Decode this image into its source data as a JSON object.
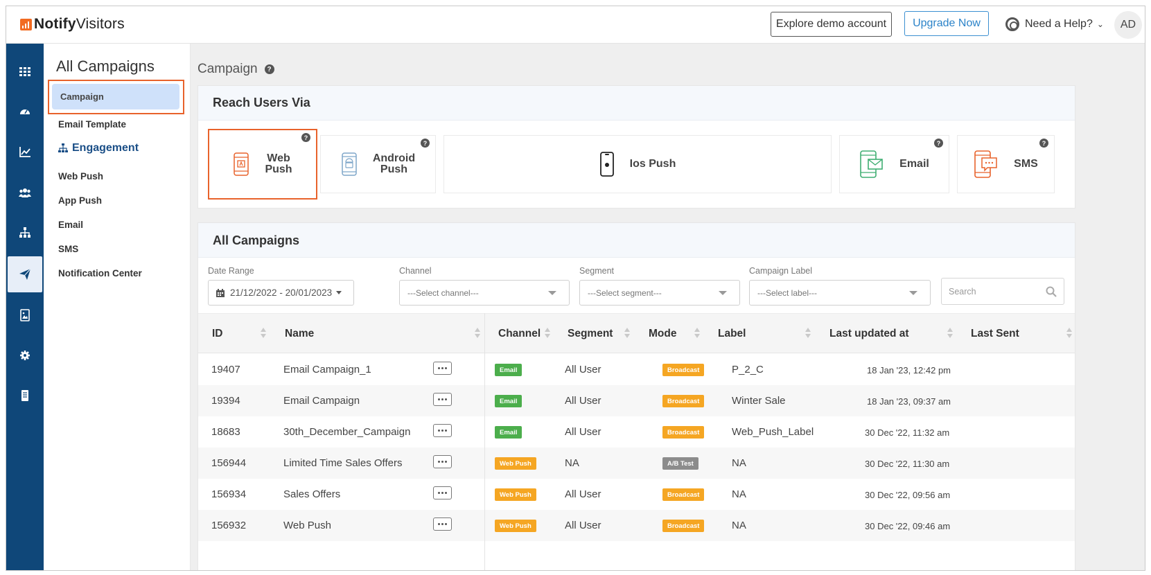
{
  "header": {
    "logo_bold": "Notify",
    "logo_regular": "Visitors",
    "demo_button": "Explore demo account",
    "upgrade_button": "Upgrade Now",
    "help_label": "Need a Help?",
    "avatar_initials": "AD"
  },
  "rail": {
    "icons": [
      "grid-icon",
      "dashboard-icon",
      "analytics-icon",
      "users-icon",
      "sitemap-icon",
      "send-icon",
      "image-icon",
      "settings-icon",
      "document-icon"
    ],
    "active_icon": "send-icon"
  },
  "subnav": {
    "title": "All Campaigns",
    "campaign": "Campaign",
    "email_template": "Email Template",
    "engagement": "Engagement",
    "items": [
      "Web Push",
      "App Push",
      "Email",
      "SMS",
      "Notification Center"
    ]
  },
  "main": {
    "page_title": "Campaign",
    "reach_title": "Reach Users Via",
    "channels": [
      {
        "line1": "Web",
        "line2": "Push",
        "icon": "web-push-icon",
        "selected": true
      },
      {
        "line1": "Android",
        "line2": "Push",
        "icon": "android-push-icon",
        "selected": false
      },
      {
        "line1": "Ios Push",
        "line2": "",
        "icon": "ios-push-icon",
        "selected": false
      },
      {
        "line1": "Email",
        "line2": "",
        "icon": "email-channel-icon",
        "selected": false
      },
      {
        "line1": "SMS",
        "line2": "",
        "icon": "sms-channel-icon",
        "selected": false
      }
    ],
    "all_title": "All Campaigns"
  },
  "filters": {
    "date_label": "Date Range",
    "date_value": "21/12/2022 - 20/01/2023",
    "channel_label": "Channel",
    "channel_value": "---Select channel---",
    "segment_label": "Segment",
    "segment_value": "---Select segment---",
    "label_label": "Campaign Label",
    "label_value": "---Select label---",
    "search_placeholder": "Search"
  },
  "table": {
    "columns": [
      "ID",
      "Name",
      "Channel",
      "Segment",
      "Mode",
      "Label",
      "Last updated at",
      "Last Sent"
    ],
    "rows": [
      {
        "id": "19407",
        "name": "Email Campaign_1",
        "channel": "Email",
        "segment": "All User",
        "mode": "Broadcast",
        "label": "P_2_C",
        "updated": "18 Jan '23, 12:42 pm"
      },
      {
        "id": "19394",
        "name": "Email Campaign",
        "channel": "Email",
        "segment": "All User",
        "mode": "Broadcast",
        "label": "Winter Sale",
        "updated": "18 Jan '23, 09:37 am"
      },
      {
        "id": "18683",
        "name": "30th_December_Campaign",
        "channel": "Email",
        "segment": "All User",
        "mode": "Broadcast",
        "label": "Web_Push_Label",
        "updated": "30 Dec '22, 11:32 am"
      },
      {
        "id": "156944",
        "name": "Limited Time Sales Offers",
        "channel": "Web Push",
        "segment": "NA",
        "mode": "A/B Test",
        "label": "NA",
        "updated": "30 Dec '22, 11:30 am"
      },
      {
        "id": "156934",
        "name": "Sales Offers",
        "channel": "Web Push",
        "segment": "All User",
        "mode": "Broadcast",
        "label": "NA",
        "updated": "30 Dec '22, 09:56 am"
      },
      {
        "id": "156932",
        "name": "Web Push",
        "channel": "Web Push",
        "segment": "All User",
        "mode": "Broadcast",
        "label": "NA",
        "updated": "30 Dec '22, 09:46 am"
      }
    ]
  },
  "colors": {
    "rail": "#0f4779",
    "highlight": "#e8622b",
    "email_badge": "#4cae4c",
    "webpush_badge": "#f5a623",
    "broadcast_badge": "#f5a623",
    "abtest_badge": "#8c8c8c"
  }
}
